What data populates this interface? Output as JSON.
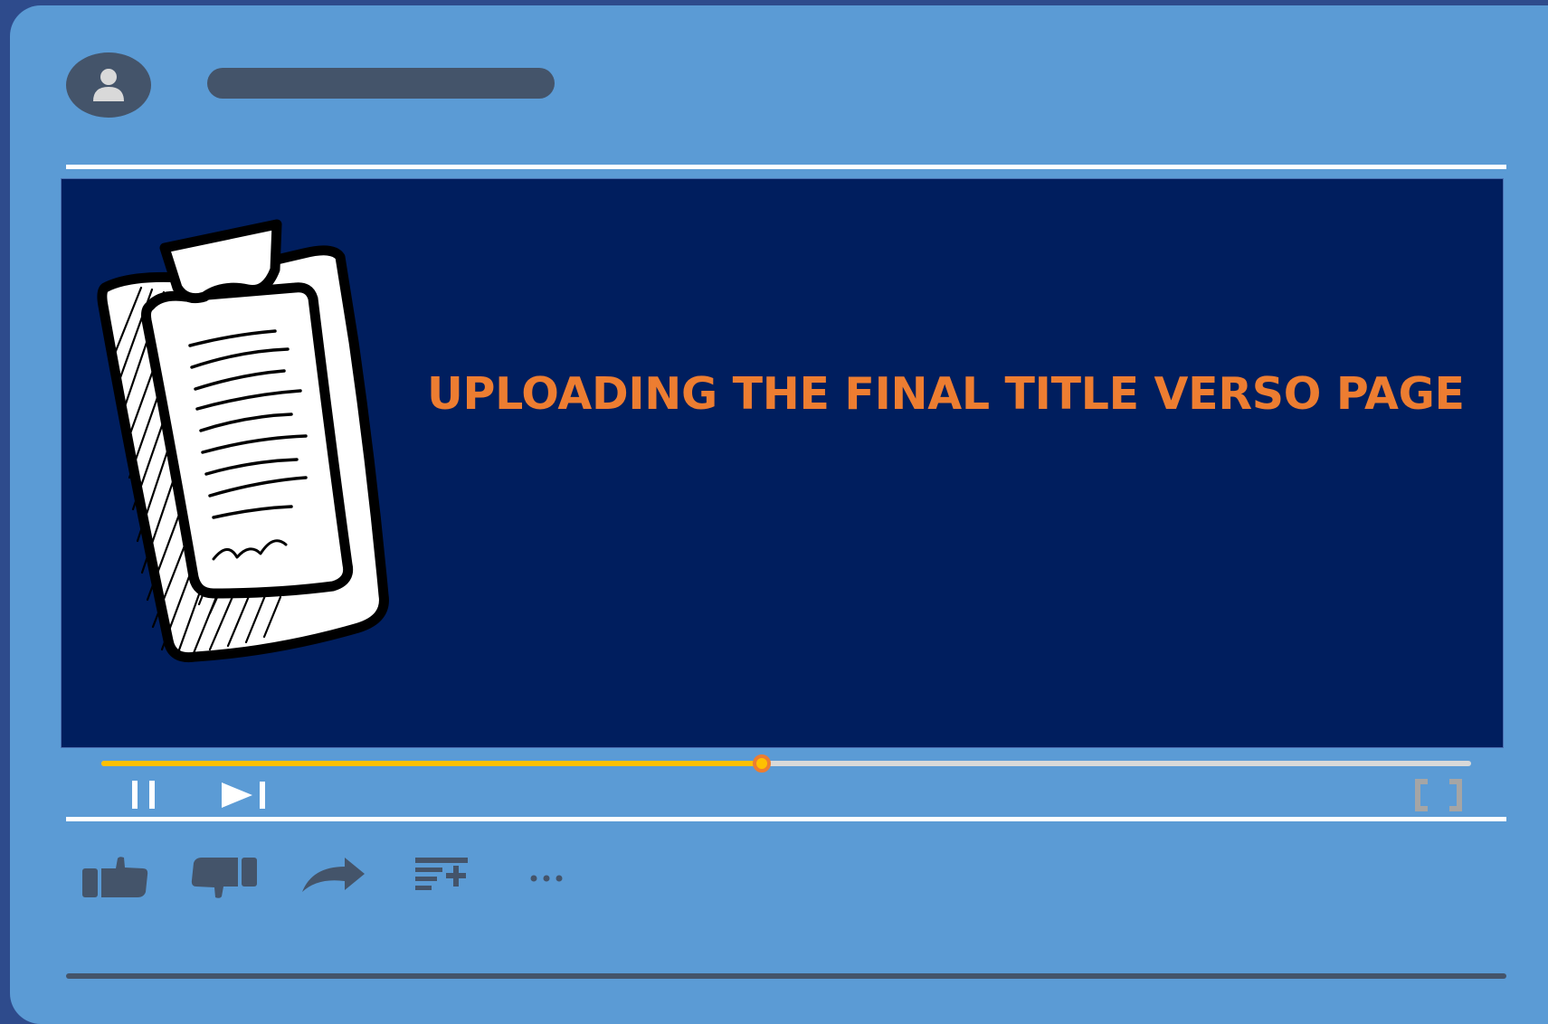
{
  "video": {
    "title": "UPLOADING THE FINAL TITLE VERSO PAGE",
    "progress_percent": 48.2
  },
  "icons": {
    "channel_avatar": "user-icon",
    "illustration": "clipboard-document-icon",
    "pause": "pause-icon",
    "next": "skip-next-icon",
    "fullscreen": "fullscreen-icon",
    "like": "thumbs-up-icon",
    "dislike": "thumbs-down-icon",
    "share": "share-arrow-icon",
    "save_to_playlist": "playlist-add-icon",
    "more": "more-horizontal-icon"
  },
  "colors": {
    "background": "#5b9bd5",
    "video_background": "#001e5e",
    "title": "#ed7d31",
    "progress_played": "#ffc000",
    "progress_track": "#d9d9d9",
    "icons": "#44546a"
  }
}
